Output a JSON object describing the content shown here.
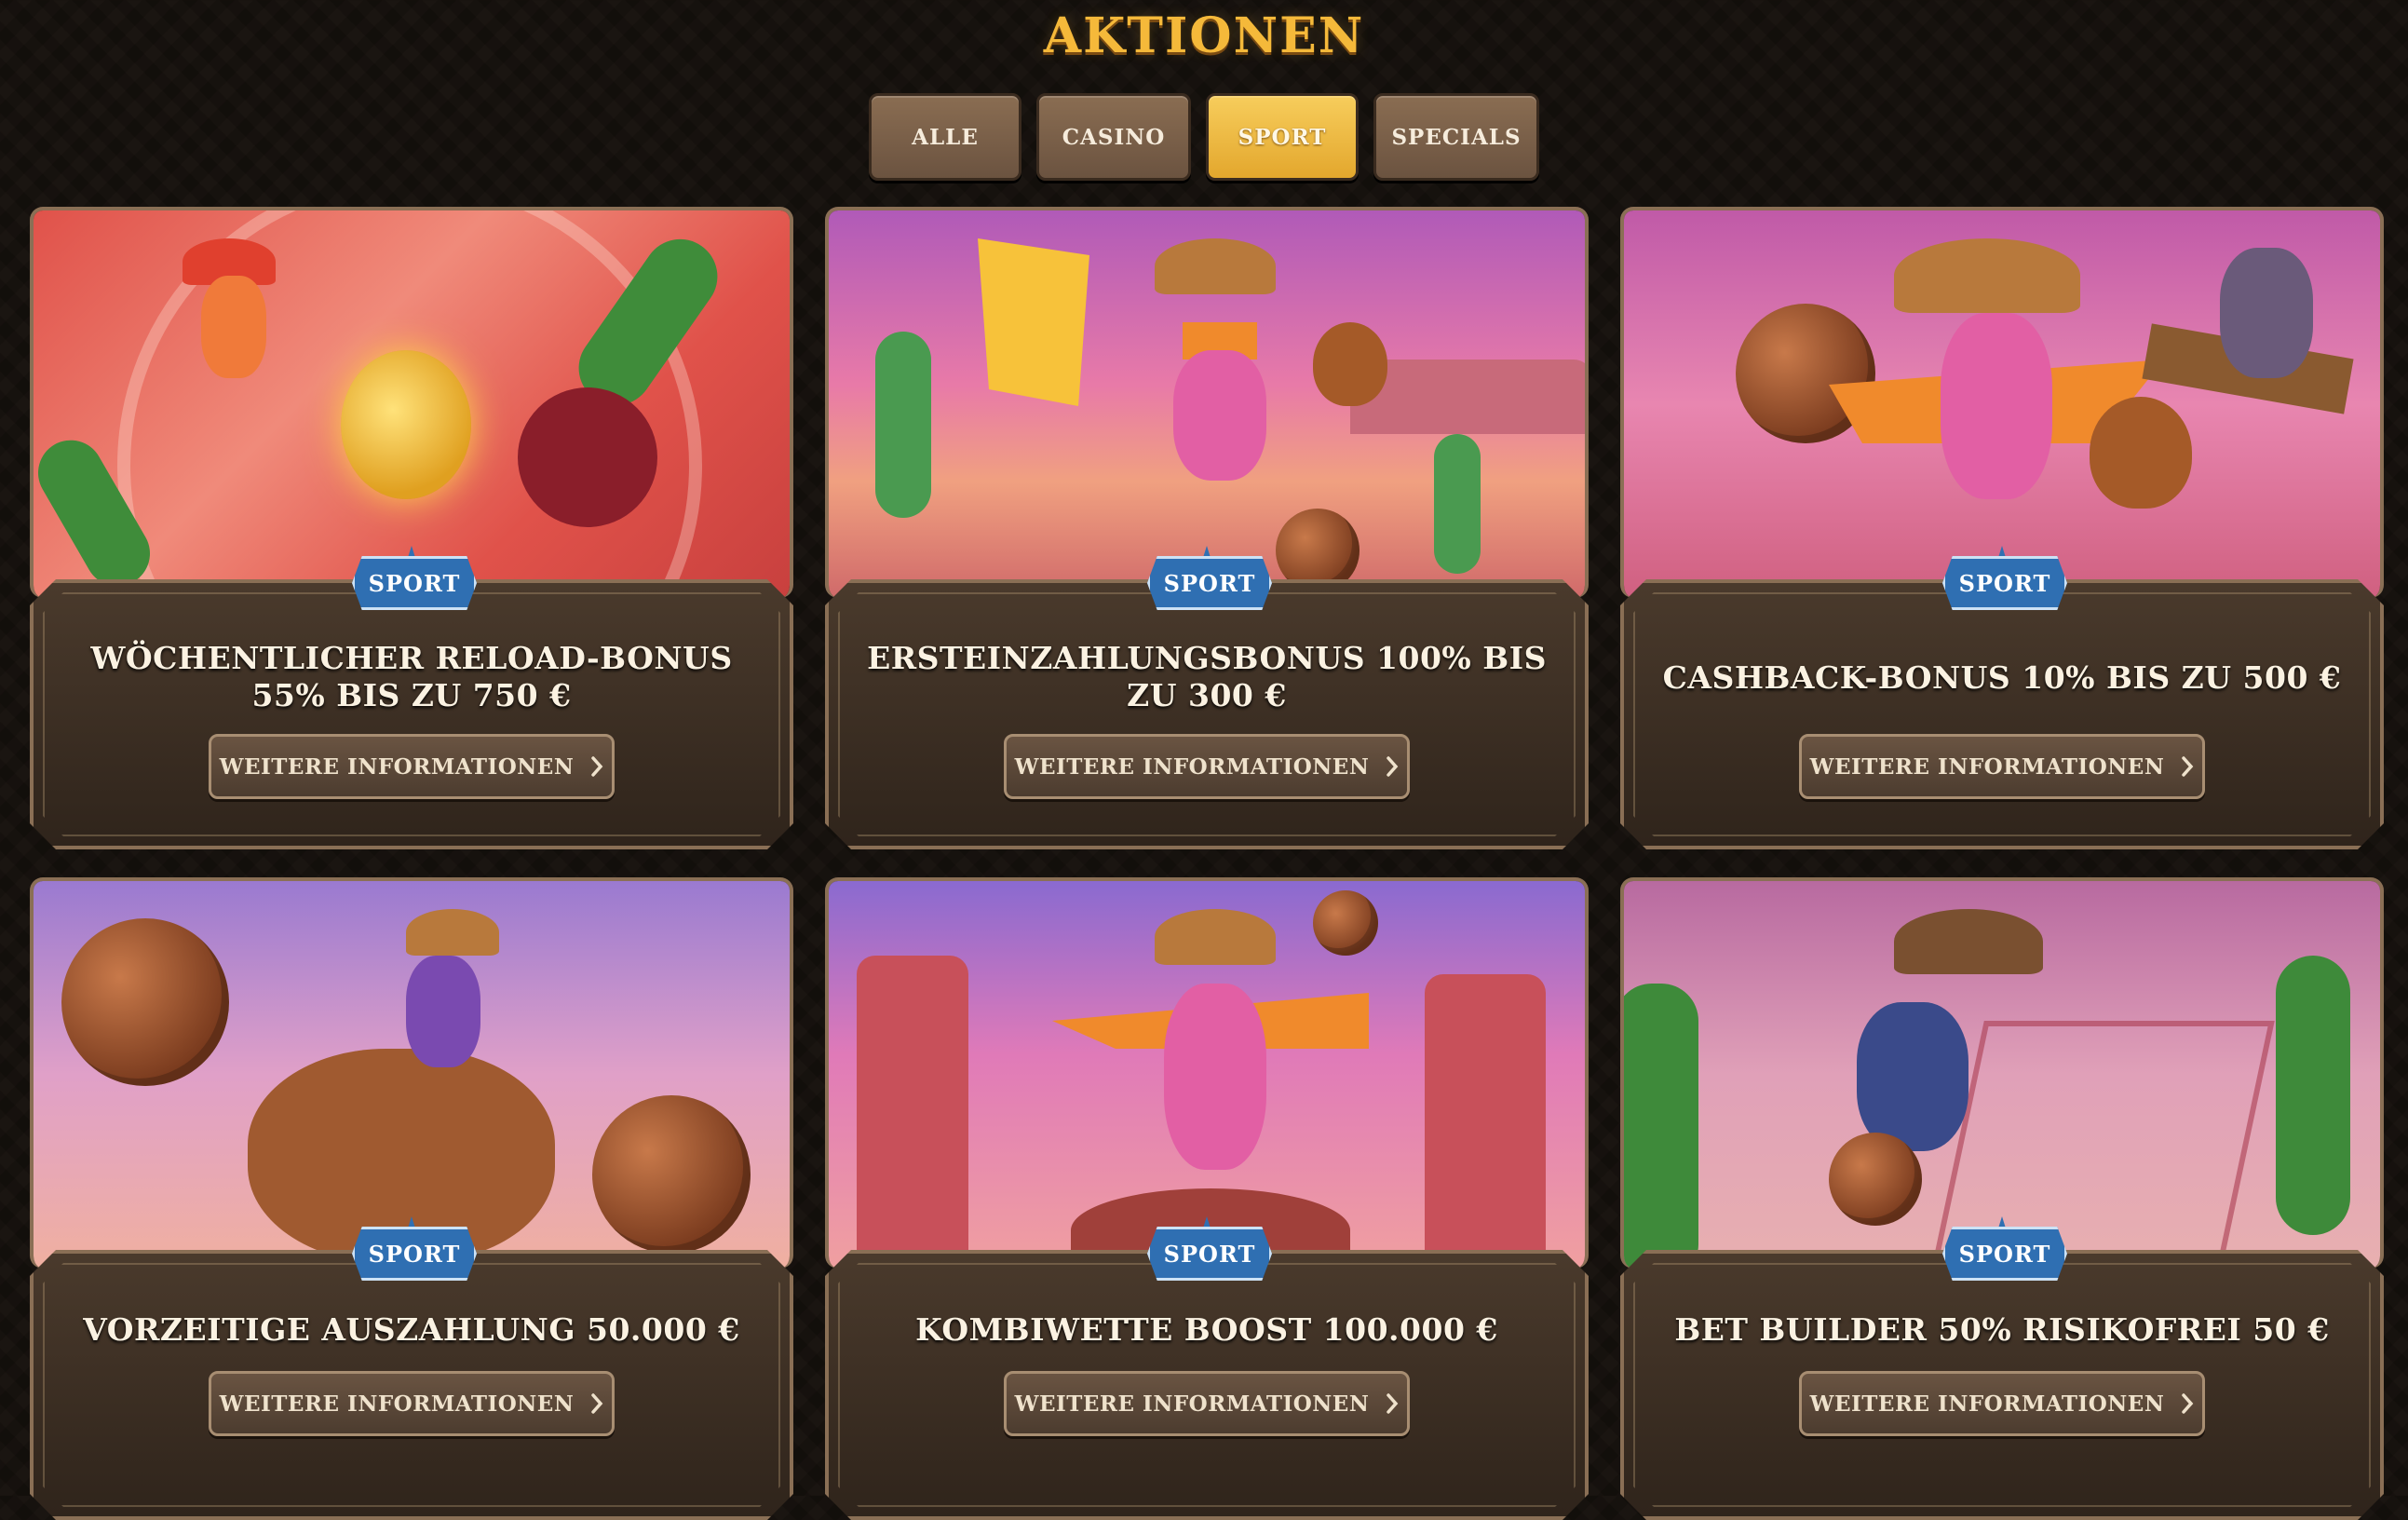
{
  "page": {
    "title": "AKTIONEN"
  },
  "tabs": [
    {
      "label": "ALLE"
    },
    {
      "label": "CASINO"
    },
    {
      "label": "SPORT",
      "active": true
    },
    {
      "label": "SPECIALS"
    }
  ],
  "colors": {
    "accent": "#f5b93a",
    "badge": "#2f6fb2",
    "active_tab": "#f0bb44"
  },
  "cards": [
    {
      "badge": "SPORT",
      "title": "WÖCHENTLICHER RELOAD-BONUS 55% BIS ZU 750 €",
      "button": "WEITERE INFORMATIONEN",
      "icon": "chevron-right-icon"
    },
    {
      "badge": "SPORT",
      "title": "ERSTEINZAHLUNGSBONUS 100% BIS ZU 300 €",
      "button": "WEITERE INFORMATIONEN",
      "icon": "chevron-right-icon"
    },
    {
      "badge": "SPORT",
      "title": "CASHBACK-BONUS 10% BIS ZU 500 €",
      "button": "WEITERE INFORMATIONEN",
      "icon": "chevron-right-icon"
    },
    {
      "badge": "SPORT",
      "title": "VORZEITIGE AUSZAHLUNG 50.000 €",
      "button": "WEITERE INFORMATIONEN",
      "icon": "chevron-right-icon"
    },
    {
      "badge": "SPORT",
      "title": "KOMBIWETTE BOOST 100.000 €",
      "button": "WEITERE INFORMATIONEN",
      "icon": "chevron-right-icon"
    },
    {
      "badge": "SPORT",
      "title": "BET BUILDER 50% RISIKOFREI 50 €",
      "button": "WEITERE INFORMATIONEN",
      "icon": "chevron-right-icon"
    }
  ]
}
